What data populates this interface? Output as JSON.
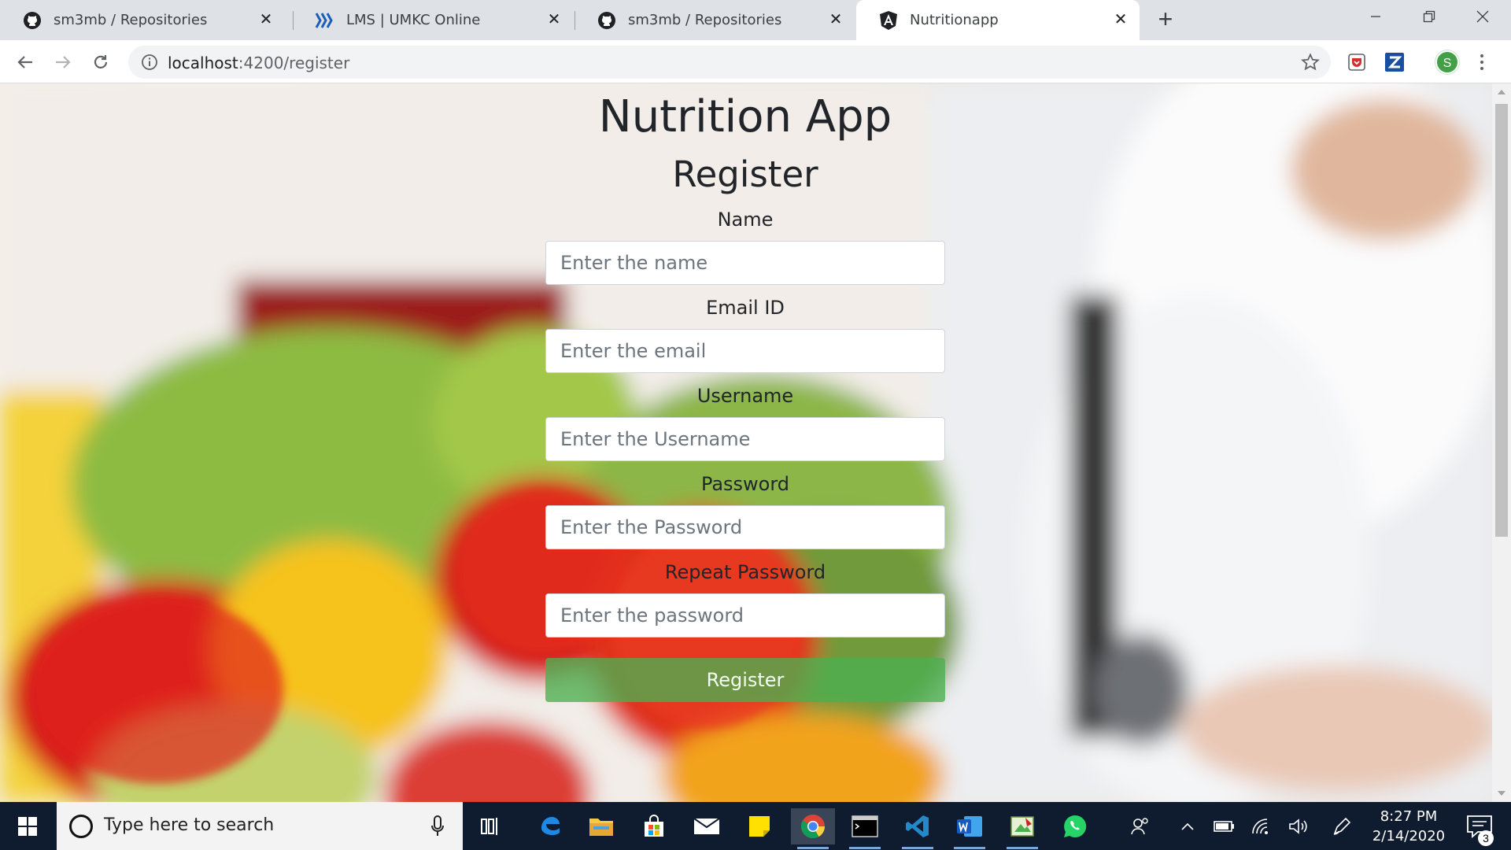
{
  "browser": {
    "tabs": [
      {
        "title": "sm3mb / Repositories",
        "favicon": "github-icon",
        "active": false
      },
      {
        "title": "LMS | UMKC Online",
        "favicon": "lms-icon",
        "active": false
      },
      {
        "title": "sm3mb / Repositories",
        "favicon": "github-icon",
        "active": false
      },
      {
        "title": "Nutritionapp",
        "favicon": "angular-icon",
        "active": true
      }
    ],
    "address": {
      "host": "localhost",
      "path": ":4200/register"
    },
    "profile_initial": "S",
    "accent": "#43a047"
  },
  "page": {
    "app_title": "Nutrition App",
    "form_title": "Register",
    "fields": [
      {
        "label": "Name",
        "placeholder": "Enter the name",
        "value": ""
      },
      {
        "label": "Email ID",
        "placeholder": "Enter the email",
        "value": ""
      },
      {
        "label": "Username",
        "placeholder": "Enter the Username",
        "value": ""
      },
      {
        "label": "Password",
        "placeholder": "Enter the Password",
        "value": ""
      },
      {
        "label": "Repeat Password",
        "placeholder": "Enter the password",
        "value": ""
      }
    ],
    "submit_label": "Register",
    "submit_color": "#4caf50"
  },
  "taskbar": {
    "search_placeholder": "Type here to search",
    "time": "8:27 PM",
    "date": "2/14/2020",
    "notification_count": "3",
    "apps": [
      "task-view-icon",
      "edge-icon",
      "file-explorer-icon",
      "store-icon",
      "mail-icon",
      "sticky-notes-icon",
      "chrome-icon",
      "terminal-icon",
      "vscode-icon",
      "word-icon",
      "paint-icon",
      "whatsapp-icon"
    ]
  }
}
